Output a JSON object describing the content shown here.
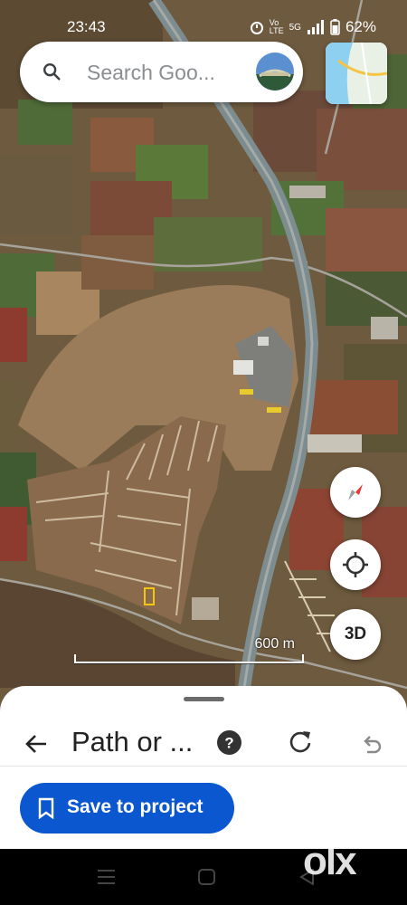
{
  "status_bar": {
    "time": "23:43",
    "network_label": "5G",
    "lte_label": "Vo\nLTE",
    "battery": "62%"
  },
  "search": {
    "placeholder": "Search Goo..."
  },
  "map": {
    "scale_label": "600 m",
    "three_d_label": "3D"
  },
  "sheet": {
    "title": "Path or ...",
    "save_label": "Save to project"
  },
  "watermark": {
    "text": "olx"
  },
  "colors": {
    "accent": "#0b57d0",
    "compass_red": "#e53935",
    "highway": "#7d8c8f"
  },
  "icons": [
    "search-icon",
    "back-arrow-icon",
    "help-icon",
    "refresh-icon",
    "undo-icon",
    "bookmark-icon",
    "compass-icon",
    "my-location-icon",
    "layers-thumbnail",
    "alarm-icon",
    "signal-icon",
    "battery-icon",
    "menu-nav-icon",
    "home-nav-icon",
    "back-nav-icon"
  ]
}
